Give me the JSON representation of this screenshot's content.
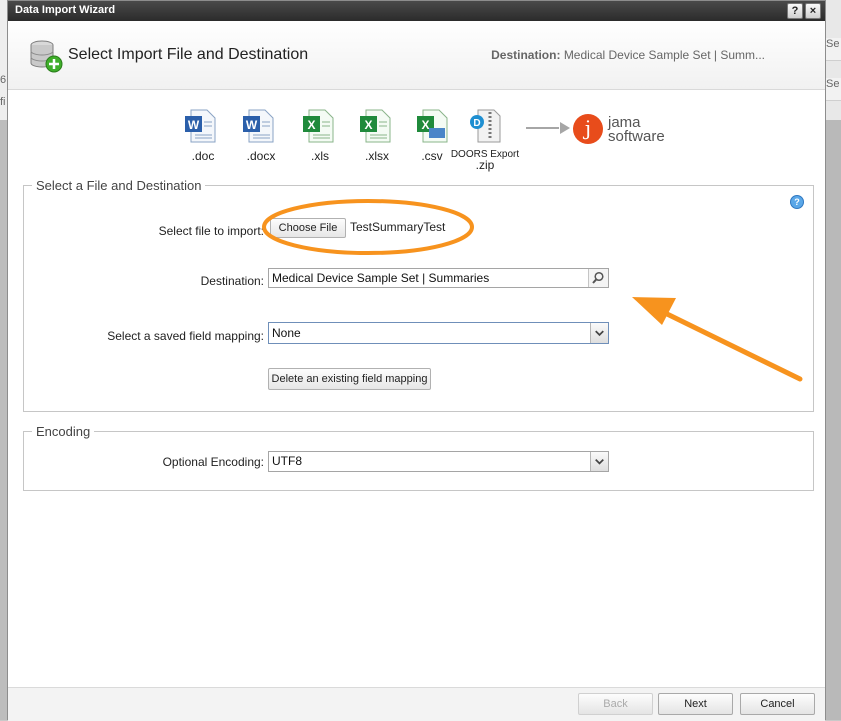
{
  "window": {
    "title": "Data Import Wizard",
    "help_btn": "?",
    "close_btn": "×"
  },
  "header": {
    "title": "Select Import File and Destination",
    "dest_label": "Destination:",
    "dest_value": "Medical Device Sample Set | Summ..."
  },
  "file_types": [
    {
      "label": ".doc"
    },
    {
      "label": ".docx"
    },
    {
      "label": ".xls"
    },
    {
      "label": ".xlsx"
    },
    {
      "label": ".csv"
    },
    {
      "label_line1": "DOORS Export",
      "label_line2": ".zip"
    }
  ],
  "brand": {
    "letter": "j",
    "line1": "jama",
    "line2": "software"
  },
  "file_section": {
    "legend": "Select a File and Destination",
    "file_label": "Select file to import:",
    "choose_file": "Choose File",
    "file_name": "TestSummaryTest",
    "dest_label": "Destination:",
    "dest_value": "Medical Device Sample Set | Summaries",
    "mapping_label": "Select a saved field mapping:",
    "mapping_value": "None",
    "delete_mapping": "Delete an existing field mapping"
  },
  "encoding_section": {
    "legend": "Encoding",
    "label": "Optional Encoding:",
    "value": "UTF8"
  },
  "footer": {
    "back": "Back",
    "next": "Next",
    "cancel": "Cancel"
  },
  "background": {
    "left_a": "6",
    "left_b": "fi",
    "right_a": "Se",
    "right_b": "Se"
  },
  "colors": {
    "accent": "#f7931e",
    "brand": "#e84c1b"
  }
}
